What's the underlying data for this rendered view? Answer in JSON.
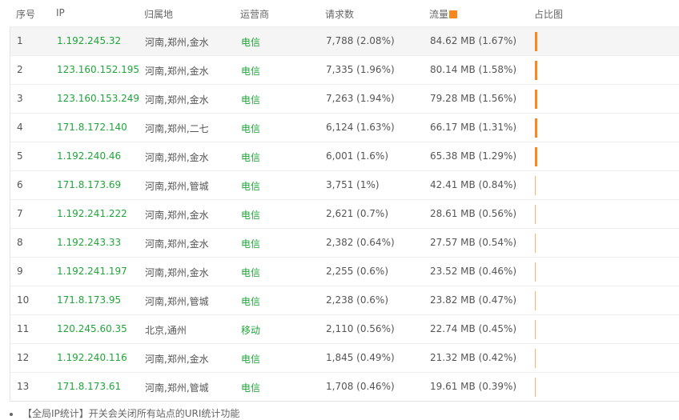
{
  "header": {
    "idx": "序号",
    "ip": "IP",
    "location": "归属地",
    "isp": "运营商",
    "requests": "请求数",
    "traffic": "流量",
    "share": "占比图"
  },
  "rows": [
    {
      "idx": "1",
      "ip": "1.192.245.32",
      "location": "河南,郑州,金水",
      "isp": "电信",
      "requests": "7,788 (2.08%)",
      "traffic": "84.62 MB (1.67%)",
      "share": 1.67
    },
    {
      "idx": "2",
      "ip": "123.160.152.195",
      "location": "河南,郑州,金水",
      "isp": "电信",
      "requests": "7,335 (1.96%)",
      "traffic": "80.14 MB (1.58%)",
      "share": 1.58
    },
    {
      "idx": "3",
      "ip": "123.160.153.249",
      "location": "河南,郑州,金水",
      "isp": "电信",
      "requests": "7,263 (1.94%)",
      "traffic": "79.28 MB (1.56%)",
      "share": 1.56
    },
    {
      "idx": "4",
      "ip": "171.8.172.140",
      "location": "河南,郑州,二七",
      "isp": "电信",
      "requests": "6,124 (1.63%)",
      "traffic": "66.17 MB (1.31%)",
      "share": 1.31
    },
    {
      "idx": "5",
      "ip": "1.192.240.46",
      "location": "河南,郑州,金水",
      "isp": "电信",
      "requests": "6,001 (1.6%)",
      "traffic": "65.38 MB (1.29%)",
      "share": 1.29
    },
    {
      "idx": "6",
      "ip": "171.8.173.69",
      "location": "河南,郑州,管城",
      "isp": "电信",
      "requests": "3,751 (1%)",
      "traffic": "42.41 MB (0.84%)",
      "share": 0.84
    },
    {
      "idx": "7",
      "ip": "1.192.241.222",
      "location": "河南,郑州,金水",
      "isp": "电信",
      "requests": "2,621 (0.7%)",
      "traffic": "28.61 MB (0.56%)",
      "share": 0.56
    },
    {
      "idx": "8",
      "ip": "1.192.243.33",
      "location": "河南,郑州,金水",
      "isp": "电信",
      "requests": "2,382 (0.64%)",
      "traffic": "27.57 MB (0.54%)",
      "share": 0.54
    },
    {
      "idx": "9",
      "ip": "1.192.241.197",
      "location": "河南,郑州,金水",
      "isp": "电信",
      "requests": "2,255 (0.6%)",
      "traffic": "23.52 MB (0.46%)",
      "share": 0.46
    },
    {
      "idx": "10",
      "ip": "171.8.173.95",
      "location": "河南,郑州,管城",
      "isp": "电信",
      "requests": "2,238 (0.6%)",
      "traffic": "23.82 MB (0.47%)",
      "share": 0.47
    },
    {
      "idx": "11",
      "ip": "120.245.60.35",
      "location": "北京,通州",
      "isp": "移动",
      "requests": "2,110 (0.56%)",
      "traffic": "22.74 MB (0.45%)",
      "share": 0.45
    },
    {
      "idx": "12",
      "ip": "1.192.240.116",
      "location": "河南,郑州,金水",
      "isp": "电信",
      "requests": "1,845 (0.49%)",
      "traffic": "21.32 MB (0.42%)",
      "share": 0.42
    },
    {
      "idx": "13",
      "ip": "171.8.173.61",
      "location": "河南,郑州,管城",
      "isp": "电信",
      "requests": "1,708 (0.46%)",
      "traffic": "19.61 MB (0.39%)",
      "share": 0.39
    }
  ],
  "footer": {
    "note": "【全局IP统计】开关会关闭所有站点的URI统计功能"
  },
  "colors": {
    "accent": "#f7881e",
    "green": "#20a53a"
  }
}
